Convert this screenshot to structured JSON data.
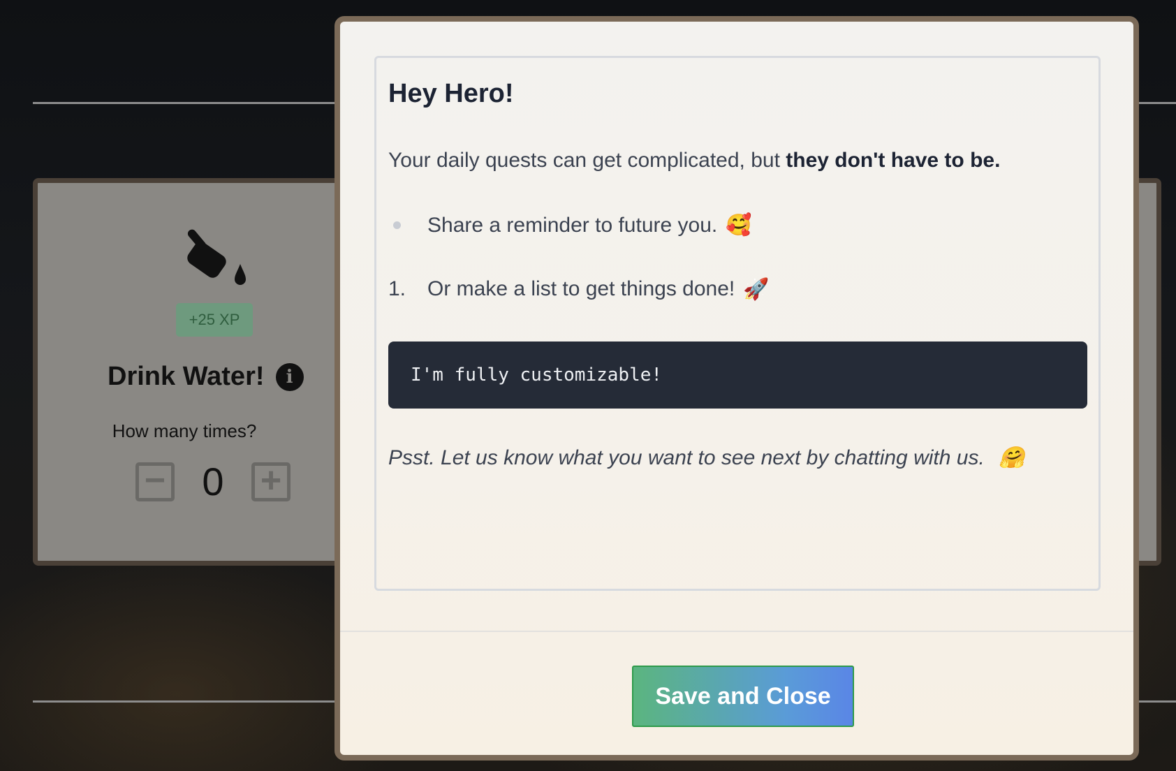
{
  "quest_card": {
    "icon": "paint-bucket-icon",
    "xp_badge": "+25 XP",
    "title": "Drink Water!",
    "info_icon": "i",
    "prompt": "How many times?",
    "count": "0",
    "minus": "−",
    "plus": "+"
  },
  "modal": {
    "heading": "Hey Hero!",
    "paragraph_plain": "Your daily quests can get complicated, but ",
    "paragraph_bold": "they don't have to be.",
    "bullet_item": "Share a reminder to future you.",
    "bullet_emoji": "🥰",
    "numbered_index": "1.",
    "numbered_item": "Or make a list to get things done!",
    "numbered_emoji": "🚀",
    "code_block": "I'm fully customizable!",
    "psst": "Psst. Let us know what you want to see next by chatting with us.",
    "psst_emoji": "🤗",
    "save_button": "Save and Close"
  },
  "colors": {
    "modal_border": "#7b6a58",
    "code_bg": "#252b37",
    "button_gradient_start": "#5bb57f",
    "button_gradient_end": "#5a86e6",
    "xp_badge_bg": "#6e9a7e"
  }
}
